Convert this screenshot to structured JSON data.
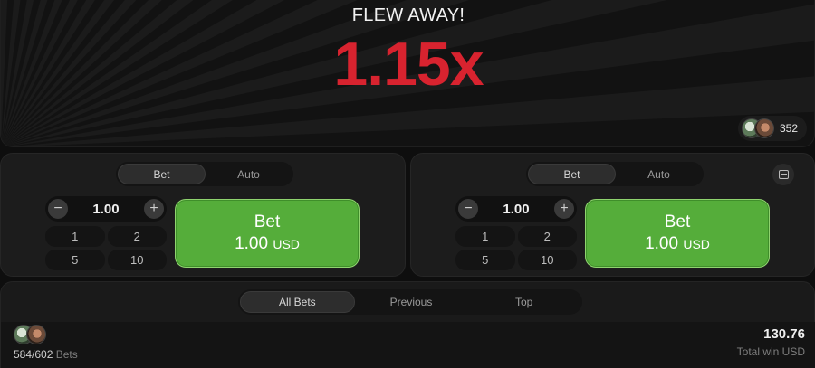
{
  "game": {
    "status_text": "FLEW AWAY!",
    "multiplier": "1.15x",
    "multiplier_color": "#d8232f",
    "player_count": "352"
  },
  "bet_panels": [
    {
      "tabs": [
        "Bet",
        "Auto"
      ],
      "active_tab": "Bet",
      "stake": "1.00",
      "quick_amounts": [
        "1",
        "2",
        "5",
        "10"
      ],
      "button_label": "Bet",
      "button_amount": "1.00",
      "button_currency": "USD"
    },
    {
      "tabs": [
        "Bet",
        "Auto"
      ],
      "active_tab": "Bet",
      "stake": "1.00",
      "quick_amounts": [
        "1",
        "2",
        "5",
        "10"
      ],
      "button_label": "Bet",
      "button_amount": "1.00",
      "button_currency": "USD"
    }
  ],
  "bets_list": {
    "tabs": [
      "All Bets",
      "Previous",
      "Top"
    ],
    "active_tab": "All Bets",
    "bet_count": "584/602",
    "bet_count_suffix": "Bets",
    "total_win": "130.76",
    "total_win_label": "Total win USD"
  },
  "colors": {
    "bet_button": "#55ad3a",
    "background": "#0e0e0e"
  }
}
